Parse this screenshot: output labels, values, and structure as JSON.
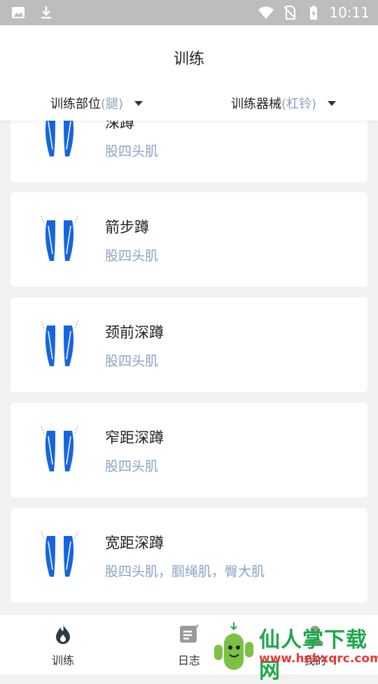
{
  "status_bar": {
    "time": "10:11"
  },
  "header": {
    "title": "训练",
    "filters": [
      {
        "label": "训练部位",
        "value": "(腿)"
      },
      {
        "label": "训练器械",
        "value": "(杠铃)"
      }
    ]
  },
  "exercises": [
    {
      "name": "深蹲",
      "muscle": "股四头肌"
    },
    {
      "name": "箭步蹲",
      "muscle": "股四头肌"
    },
    {
      "name": "颈前深蹲",
      "muscle": "股四头肌"
    },
    {
      "name": "窄距深蹲",
      "muscle": "股四头肌"
    },
    {
      "name": "宽距深蹲",
      "muscle": "股四头肌，腘绳肌，臀大肌"
    }
  ],
  "bottom_nav": [
    {
      "label": "训练",
      "icon": "flame-icon",
      "active": true
    },
    {
      "label": "日志",
      "icon": "notes-icon",
      "active": false
    },
    {
      "label": "我的",
      "icon": "profile-icon",
      "active": false
    }
  ],
  "watermark": {
    "line1": "仙人掌下载网",
    "line2": "www.hebxqrc.com"
  },
  "colors": {
    "accent_text": "#8aa4c4",
    "muscle_blue": "#1565e0",
    "status_bar": "#bdbdbd"
  }
}
